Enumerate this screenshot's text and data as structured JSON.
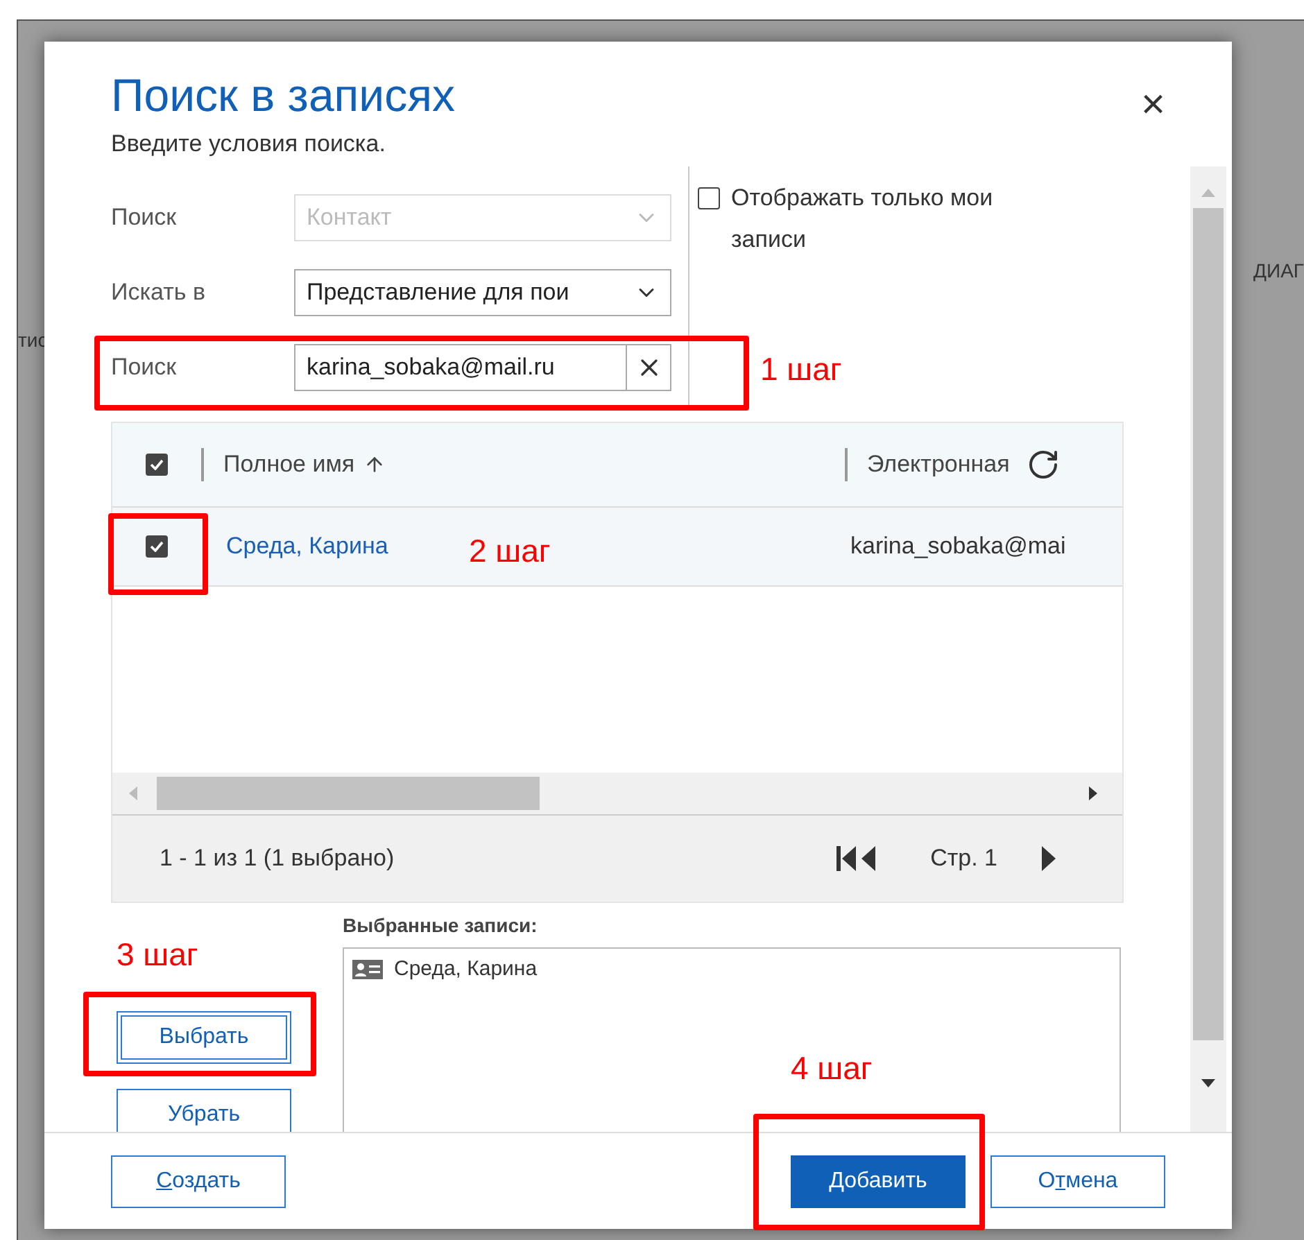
{
  "background": {
    "fragments": [
      "ДИАГ",
      "тис"
    ]
  },
  "dialog": {
    "title": "Поиск в записях",
    "subtitle": "Введите условия поиска.",
    "close": "×"
  },
  "form": {
    "fields": [
      {
        "label": "Поиск",
        "value": "Контакт",
        "kind": "select",
        "disabled": true
      },
      {
        "label": "Искать в",
        "value": "Представление для пои",
        "kind": "select",
        "disabled": false
      },
      {
        "label": "Поиск",
        "value": "karina_sobaka@mail.ru",
        "kind": "search",
        "disabled": false
      }
    ],
    "only_mine": {
      "label": "Отображать только мои записи",
      "checked": false
    }
  },
  "grid": {
    "all_checked": true,
    "columns": [
      "Полное имя",
      "Электронная"
    ],
    "rows": [
      {
        "name": "Среда, Карина",
        "email": "karina_sobaka@mai",
        "selected": true
      }
    ],
    "summary": "1 - 1 из 1 (1 выбрано)",
    "page": "Стр. 1"
  },
  "side_buttons": [
    {
      "label": "Выбрать",
      "focused": true
    },
    {
      "label": "Убрать",
      "focused": false
    }
  ],
  "selected_records": {
    "title": "Выбранные записи:",
    "items": [
      "Среда, Карина"
    ]
  },
  "footer_buttons": [
    {
      "key": "С",
      "after": "оздать",
      "kind": "secondary"
    },
    {
      "before": "Добавить",
      "kind": "primary"
    },
    {
      "before": "О",
      "key": "т",
      "after": "мена",
      "kind": "secondary"
    }
  ],
  "annotations": [
    {
      "label": "1 шаг"
    },
    {
      "label": "2 шаг"
    },
    {
      "label": "3 шаг"
    },
    {
      "label": "4 шаг"
    }
  ]
}
